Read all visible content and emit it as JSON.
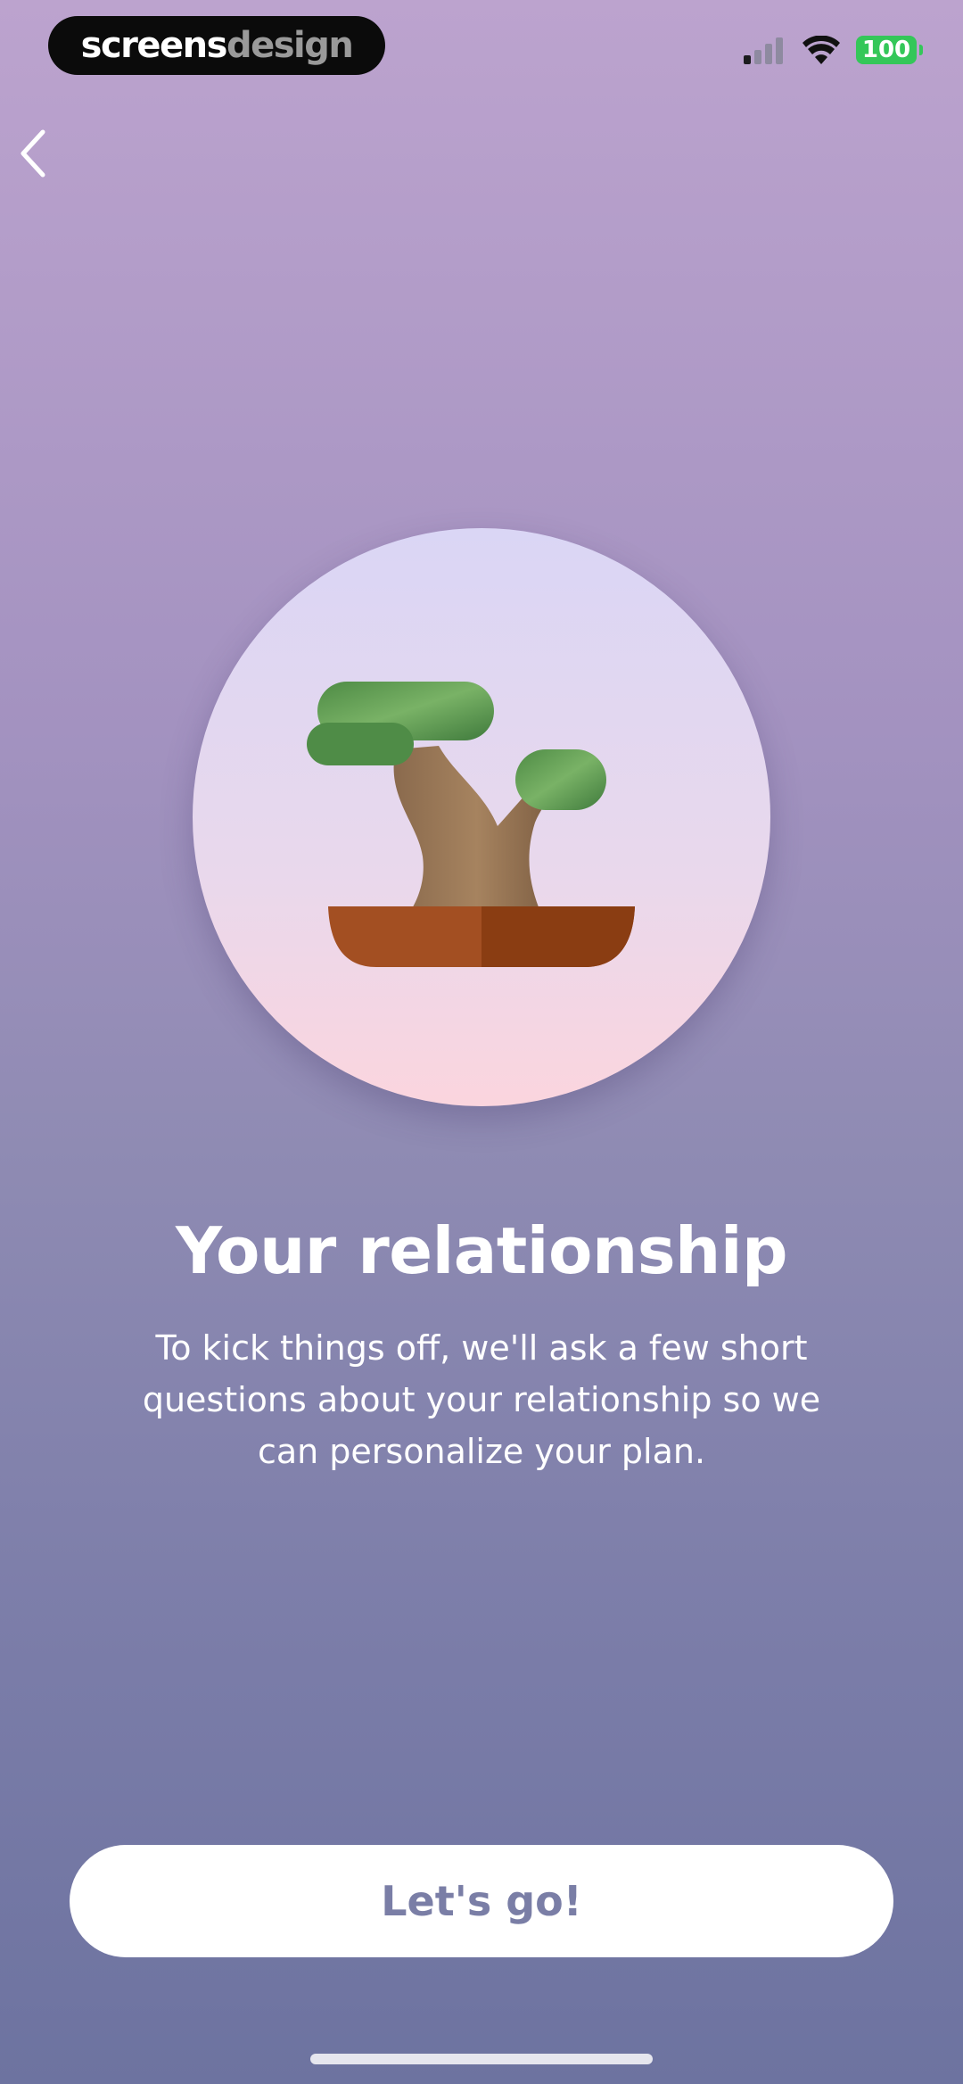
{
  "watermark": {
    "part1": "screens",
    "part2": "design"
  },
  "status_bar": {
    "battery": "100",
    "icons": [
      "signal-icon",
      "wifi-icon",
      "battery-icon"
    ],
    "battery_color": "#34c759"
  },
  "nav": {
    "back_icon": "chevron-left-icon"
  },
  "hero": {
    "illustration": "bonsai-tree-illustration"
  },
  "content": {
    "title": "Your relationship",
    "line1": "To kick things off, we'll ask a few short",
    "line2": "questions about your relationship so we",
    "line3": "can personalize your plan."
  },
  "cta": {
    "label": "Let's go!"
  },
  "colors": {
    "bg_top": "#bca3ce",
    "bg_bottom": "#6d73a0",
    "button_text": "#7a7ea6"
  }
}
